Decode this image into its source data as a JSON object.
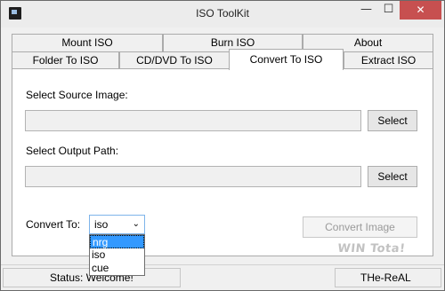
{
  "window": {
    "title": "ISO ToolKit",
    "min_glyph": "—",
    "max_glyph": "☐",
    "close_glyph": "✕"
  },
  "tabs": {
    "row1": [
      "Mount ISO",
      "Burn ISO",
      "About"
    ],
    "row2": [
      "Folder To ISO",
      "CD/DVD To ISO",
      "Convert To ISO",
      "Extract ISO"
    ],
    "active": "Convert To ISO"
  },
  "panel": {
    "source_label": "Select Source Image:",
    "source_value": "",
    "source_button": "Select",
    "output_label": "Select Output Path:",
    "output_value": "",
    "output_button": "Select",
    "convert_to_label": "Convert To:",
    "convert_to_value": "iso",
    "convert_options": [
      "nrg",
      "iso",
      "cue"
    ],
    "highlighted_option": "nrg",
    "convert_button": "Convert Image"
  },
  "watermark": {
    "text": "WIN Tota!"
  },
  "status": {
    "status_text": "Status: Welcome!",
    "author_text": "THe-ReAL"
  },
  "colors": {
    "close_button": "#c75050",
    "selection": "#3399ff",
    "window_bg": "#f0f0f0"
  }
}
